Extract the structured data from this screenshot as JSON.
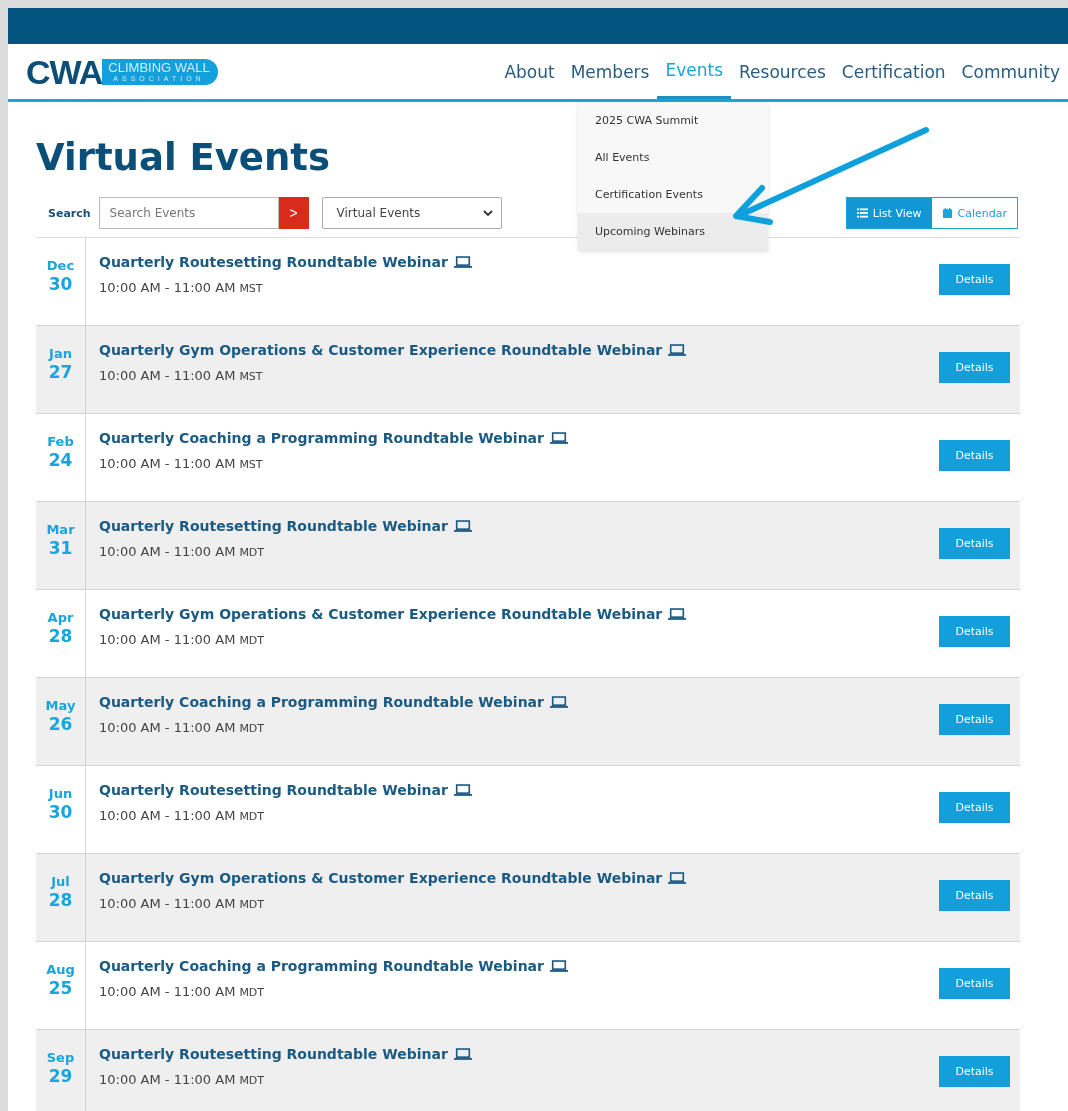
{
  "logo": {
    "mark": "CWA",
    "line1": "CLIMBING WALL",
    "line2": "ASSOCIATION"
  },
  "nav": [
    {
      "label": "About",
      "selected": false
    },
    {
      "label": "Members",
      "selected": false
    },
    {
      "label": "Events",
      "selected": true
    },
    {
      "label": "Resources",
      "selected": false
    },
    {
      "label": "Certification",
      "selected": false
    },
    {
      "label": "Community",
      "selected": false
    }
  ],
  "dropdown": [
    {
      "label": "2025 CWA Summit",
      "selected": false
    },
    {
      "label": "All Events",
      "selected": false
    },
    {
      "label": "Certification Events",
      "selected": false
    },
    {
      "label": "Upcoming Webinars",
      "selected": true
    }
  ],
  "title": "Virtual Events",
  "search": {
    "label": "Search",
    "placeholder": "Search Events",
    "go": ">",
    "filter": "Virtual Events"
  },
  "views": [
    {
      "label": "List View",
      "kind": "list",
      "selected": true
    },
    {
      "label": "Calendar",
      "kind": "calendar",
      "selected": false
    }
  ],
  "events": [
    {
      "month": "Dec",
      "day": "30",
      "title": "Quarterly Routesetting Roundtable Webinar",
      "time": "10:00 AM - 11:00 AM",
      "tz": "MST",
      "button": "Details"
    },
    {
      "month": "Jan",
      "day": "27",
      "title": "Quarterly Gym Operations & Customer Experience Roundtable Webinar",
      "time": "10:00 AM - 11:00 AM",
      "tz": "MST",
      "button": "Details"
    },
    {
      "month": "Feb",
      "day": "24",
      "title": "Quarterly Coaching a Programming Roundtable Webinar",
      "time": "10:00 AM - 11:00 AM",
      "tz": "MST",
      "button": "Details"
    },
    {
      "month": "Mar",
      "day": "31",
      "title": "Quarterly Routesetting Roundtable Webinar",
      "time": "10:00 AM - 11:00 AM",
      "tz": "MDT",
      "button": "Details"
    },
    {
      "month": "Apr",
      "day": "28",
      "title": "Quarterly Gym Operations & Customer Experience Roundtable Webinar",
      "time": "10:00 AM - 11:00 AM",
      "tz": "MDT",
      "button": "Details"
    },
    {
      "month": "May",
      "day": "26",
      "title": "Quarterly Coaching a Programming Roundtable Webinar",
      "time": "10:00 AM - 11:00 AM",
      "tz": "MDT",
      "button": "Details"
    },
    {
      "month": "Jun",
      "day": "30",
      "title": "Quarterly Routesetting Roundtable Webinar",
      "time": "10:00 AM - 11:00 AM",
      "tz": "MDT",
      "button": "Details"
    },
    {
      "month": "Jul",
      "day": "28",
      "title": "Quarterly Gym Operations & Customer Experience Roundtable Webinar",
      "time": "10:00 AM - 11:00 AM",
      "tz": "MDT",
      "button": "Details"
    },
    {
      "month": "Aug",
      "day": "25",
      "title": "Quarterly Coaching a Programming Roundtable Webinar",
      "time": "10:00 AM - 11:00 AM",
      "tz": "MDT",
      "button": "Details"
    },
    {
      "month": "Sep",
      "day": "29",
      "title": "Quarterly Routesetting Roundtable Webinar",
      "time": "10:00 AM - 11:00 AM",
      "tz": "MDT",
      "button": "Details"
    }
  ]
}
